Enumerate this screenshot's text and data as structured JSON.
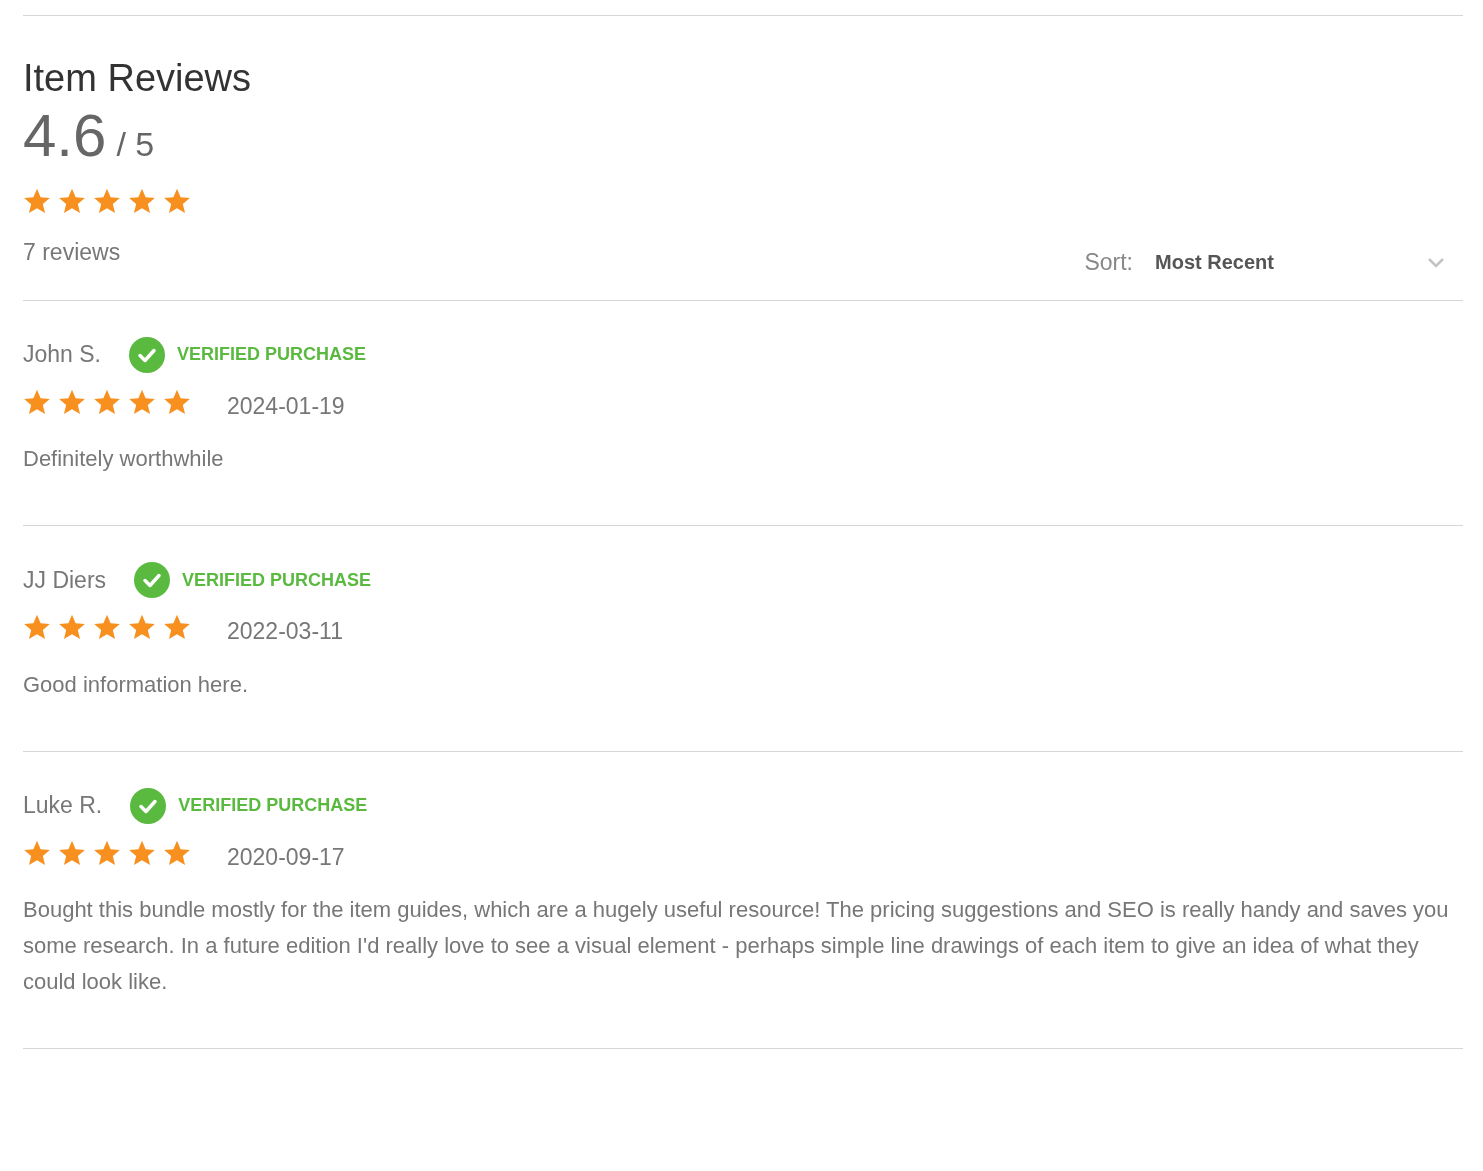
{
  "header": {
    "title": "Item Reviews",
    "score": "4.6",
    "out_of": "/ 5",
    "stars": 5,
    "review_count": "7 reviews"
  },
  "sort": {
    "label": "Sort:",
    "value": "Most Recent"
  },
  "reviews": [
    {
      "name": "John S.",
      "verified": true,
      "badge": "VERIFIED PURCHASE",
      "stars": 5,
      "date": "2024-01-19",
      "text": "Definitely worthwhile"
    },
    {
      "name": "JJ Diers",
      "verified": true,
      "badge": "VERIFIED PURCHASE",
      "stars": 5,
      "date": "2022-03-11",
      "text": "Good information here."
    },
    {
      "name": "Luke R.",
      "verified": true,
      "badge": "VERIFIED PURCHASE",
      "stars": 5,
      "date": "2020-09-17",
      "text": "Bought this bundle mostly for the item guides, which are a hugely useful resource! The pricing suggestions and SEO is really handy and saves you some research. In a future edition I'd really love to see a visual element - perhaps simple line drawings of each item to give an idea of what they could look like."
    }
  ]
}
